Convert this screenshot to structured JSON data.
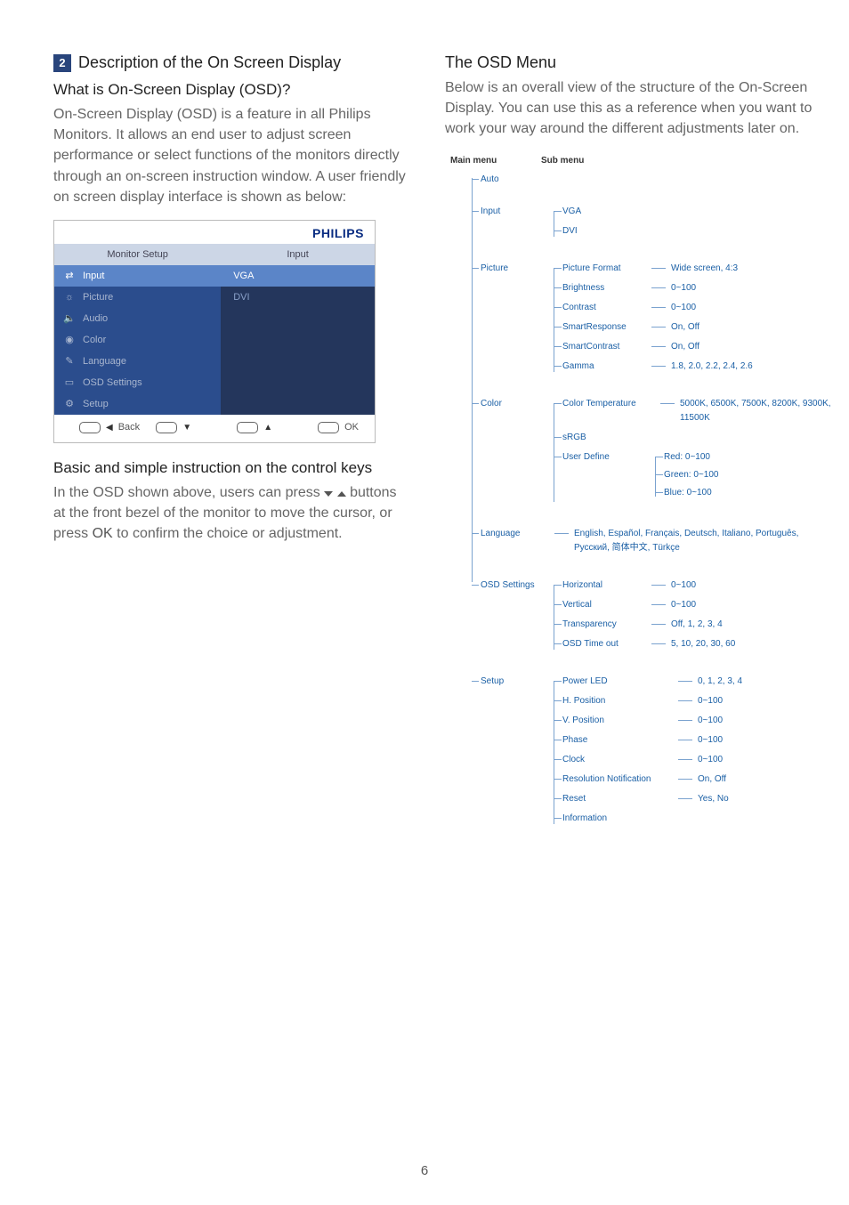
{
  "page_number": "6",
  "left": {
    "section_number": "2",
    "section_title": "Description of the On Screen Display",
    "q_heading": "What is On-Screen Display (OSD)?",
    "q_body": "On-Screen Display (OSD) is a feature in all Philips Monitors. It allows an end user to adjust screen performance or select functions of the monitors directly through an on-screen instruction window. A user friendly on screen display interface is shown as below:",
    "basic_heading": "Basic and simple instruction on the control keys",
    "basic_body_1": "In the OSD shown above, users can press ",
    "basic_body_2": " buttons at the front bezel of the monitor to move the cursor, or press ",
    "basic_body_ok": "OK",
    "basic_body_3": " to confirm the choice or adjustment."
  },
  "osd": {
    "brand": "PHILIPS",
    "header_left": "Monitor Setup",
    "header_right": "Input",
    "menu": [
      {
        "icon": "⇄",
        "label": "Input"
      },
      {
        "icon": "☼",
        "label": "Picture"
      },
      {
        "icon": "🔈",
        "label": "Audio"
      },
      {
        "icon": "◉",
        "label": "Color"
      },
      {
        "icon": "✎",
        "label": "Language"
      },
      {
        "icon": "▭",
        "label": "OSD Settings"
      },
      {
        "icon": "⚙",
        "label": "Setup"
      }
    ],
    "right_options": [
      "VGA",
      "DVI"
    ],
    "footer": {
      "back": "Back",
      "ok": "OK"
    }
  },
  "right": {
    "heading": "The OSD Menu",
    "body": "Below is an overall view of the structure of the On-Screen Display. You can use this as a reference when you want to work your way around the different adjustments later on.",
    "col_main": "Main menu",
    "col_sub": "Sub menu",
    "tree": {
      "auto": "Auto",
      "input": {
        "name": "Input",
        "items": [
          "VGA",
          "DVI"
        ]
      },
      "picture": {
        "name": "Picture",
        "items": [
          {
            "name": "Picture Format",
            "val": "Wide screen, 4:3"
          },
          {
            "name": "Brightness",
            "val": "0~100"
          },
          {
            "name": "Contrast",
            "val": "0~100"
          },
          {
            "name": "SmartResponse",
            "val": "On, Off"
          },
          {
            "name": "SmartContrast",
            "val": "On, Off"
          },
          {
            "name": "Gamma",
            "val": "1.8, 2.0, 2.2, 2.4, 2.6"
          }
        ]
      },
      "color": {
        "name": "Color",
        "items": [
          {
            "name": "Color Temperature",
            "val": "5000K, 6500K, 7500K, 8200K, 9300K, 11500K"
          },
          {
            "name": "sRGB"
          },
          {
            "name": "User Define",
            "sub": [
              "Red: 0~100",
              "Green: 0~100",
              "Blue: 0~100"
            ]
          }
        ]
      },
      "language": {
        "name": "Language",
        "val": "English, Español, Français, Deutsch, Italiano, Português, Русский, 简体中文, Türkçe"
      },
      "osd_settings": {
        "name": "OSD Settings",
        "items": [
          {
            "name": "Horizontal",
            "val": "0~100"
          },
          {
            "name": "Vertical",
            "val": "0~100"
          },
          {
            "name": "Transparency",
            "val": "Off, 1, 2, 3, 4"
          },
          {
            "name": "OSD Time out",
            "val": "5, 10, 20, 30, 60"
          }
        ]
      },
      "setup": {
        "name": "Setup",
        "items": [
          {
            "name": "Power LED",
            "val": "0, 1, 2, 3, 4"
          },
          {
            "name": "H. Position",
            "val": "0~100"
          },
          {
            "name": "V. Position",
            "val": "0~100"
          },
          {
            "name": "Phase",
            "val": "0~100"
          },
          {
            "name": "Clock",
            "val": "0~100"
          },
          {
            "name": "Resolution Notification",
            "val": "On, Off"
          },
          {
            "name": "Reset",
            "val": "Yes, No"
          },
          {
            "name": "Information"
          }
        ]
      }
    }
  }
}
